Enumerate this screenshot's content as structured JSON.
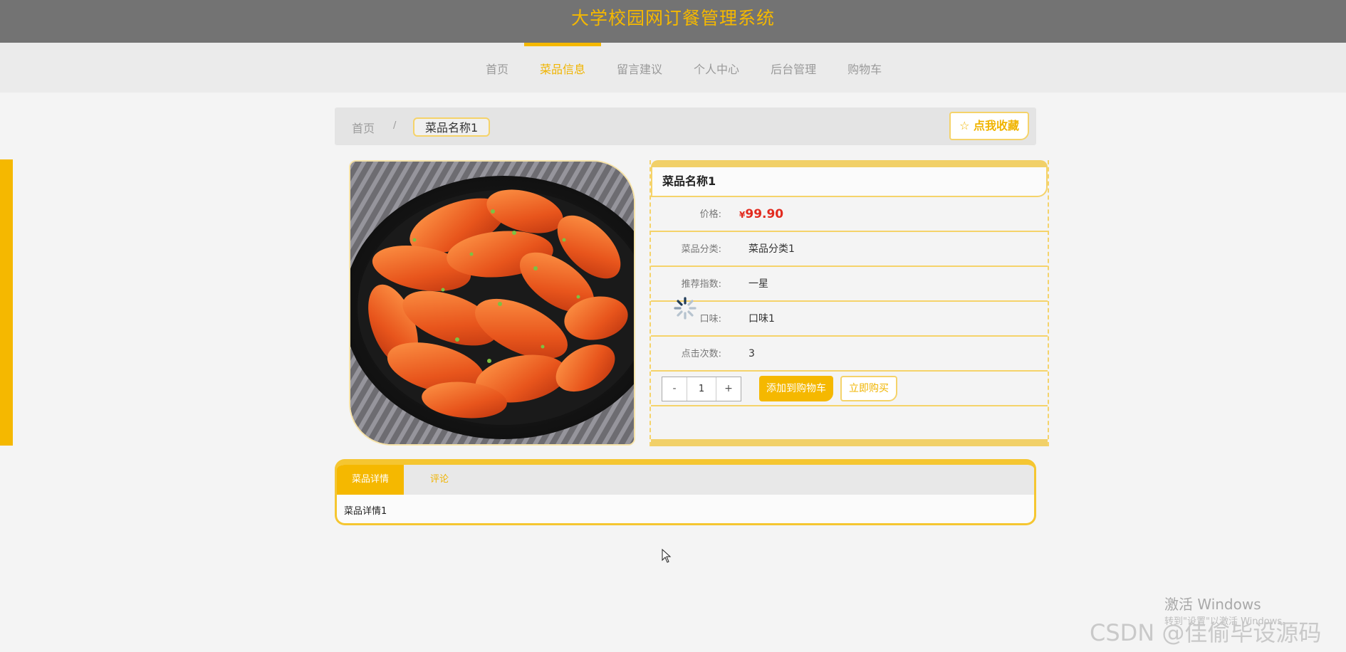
{
  "header": {
    "site_title": "大学校园网订餐管理系统"
  },
  "nav": {
    "items": [
      {
        "label": "首页",
        "active": false
      },
      {
        "label": "菜品信息",
        "active": true
      },
      {
        "label": "留言建议",
        "active": false
      },
      {
        "label": "个人中心",
        "active": false
      },
      {
        "label": "后台管理",
        "active": false
      },
      {
        "label": "购物车",
        "active": false
      }
    ]
  },
  "breadcrumb": {
    "home": "首页",
    "separator": "/",
    "current": "菜品名称1"
  },
  "favorite": {
    "icon": "star-outline-icon",
    "label": "点我收藏"
  },
  "dish": {
    "image_desc_icon": "dish-photo",
    "name": "菜品名称1",
    "price_label": "价格:",
    "price_currency": "¥",
    "price_value": "99.90",
    "category_label": "菜品分类:",
    "category_value": "菜品分类1",
    "rating_label": "推荐指数:",
    "rating_value": "一星",
    "taste_label": "口味:",
    "taste_value": "口味1",
    "clicks_label": "点击次数:",
    "clicks_value": "3"
  },
  "purchase": {
    "minus": "-",
    "quantity": "1",
    "plus": "+",
    "add_to_cart": "添加到购物车",
    "buy_now": "立即购买"
  },
  "tabs": {
    "items": [
      {
        "label": "菜品详情",
        "active": true
      },
      {
        "label": "评论",
        "active": false
      }
    ],
    "content": "菜品详情1"
  },
  "watermarks": {
    "windows_line1": "激活 Windows",
    "windows_line2": "转到\"设置\"以激活 Windows。",
    "csdn": "CSDN @佳偷毕设源码"
  },
  "colors": {
    "accent": "#f5b800",
    "header_bg": "#737373",
    "price": "#e22b1f",
    "border": "#f5d36a"
  }
}
